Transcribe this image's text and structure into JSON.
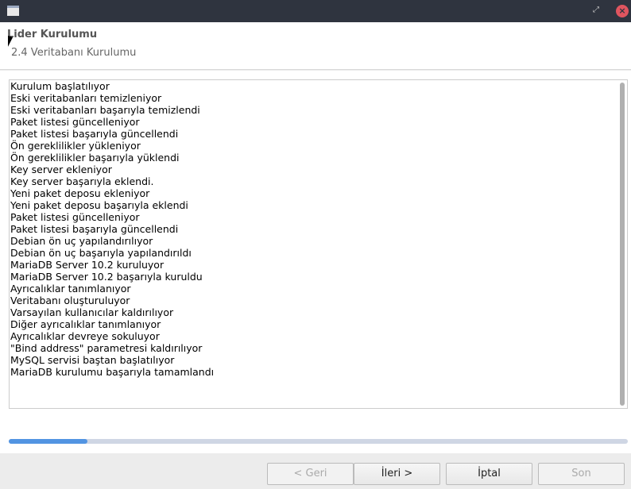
{
  "header": {
    "title": "Lider Kurulumu",
    "subtitle": "2.4 Veritabanı Kurulumu"
  },
  "log": [
    "Kurulum başlatılıyor",
    "Eski veritabanları temizleniyor",
    "Eski veritabanları başarıyla temizlendi",
    "Paket listesi güncelleniyor",
    "Paket listesi başarıyla güncellendi",
    "Ön gereklilikler yükleniyor",
    "Ön gereklilikler başarıyla yüklendi",
    "Key server ekleniyor",
    "Key server başarıyla eklendi.",
    "Yeni paket deposu ekleniyor",
    "Yeni paket deposu başarıyla eklendi",
    "Paket listesi güncelleniyor",
    "Paket listesi başarıyla güncellendi",
    "Debian ön uç yapılandırılıyor",
    "Debian ön uç başarıyla yapılandırıldı",
    "MariaDB Server 10.2 kuruluyor",
    "MariaDB Server 10.2 başarıyla kuruldu",
    "Ayrıcalıklar tanımlanıyor",
    "Veritabanı oluşturuluyor",
    "Varsayılan kullanıcılar kaldırılıyor",
    "Diğer ayrıcalıklar tanımlanıyor",
    "Ayrıcalıklar devreye sokuluyor",
    "\"Bind address\" parametresi kaldırılıyor",
    "MySQL servisi baştan başlatılıyor",
    "MariaDB kurulumu başarıyla tamamlandı"
  ],
  "progress": {
    "percent": 12.7,
    "color": "#5294e2"
  },
  "buttons": {
    "back": "< Geri",
    "next": "İleri >",
    "cancel": "İptal",
    "finish": "Son"
  }
}
